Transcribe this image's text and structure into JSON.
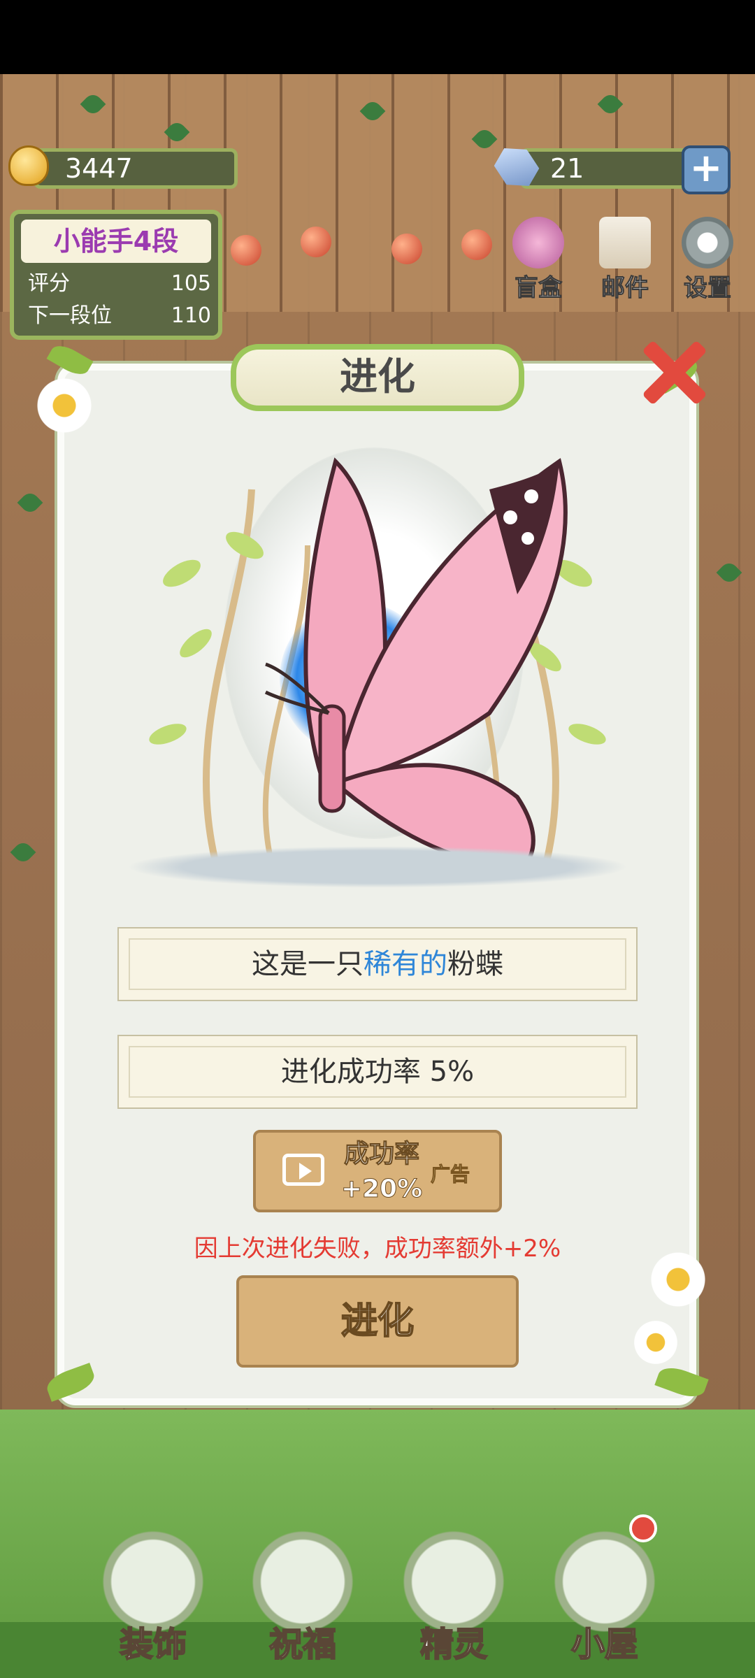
{
  "header": {
    "coins": "3447",
    "gems": "21",
    "plus_label": "+"
  },
  "rank": {
    "title": "小能手4段",
    "score_label": "评分",
    "score_value": "105",
    "next_label": "下一段位",
    "next_value": "110"
  },
  "top_buttons": [
    {
      "label": "盲盒",
      "icon": "blind-box-icon"
    },
    {
      "label": "邮件",
      "icon": "mail-icon"
    },
    {
      "label": "设置",
      "icon": "gear-icon"
    }
  ],
  "dialog": {
    "title": "进化",
    "desc_prefix": "这是一只",
    "desc_highlight": "稀有的",
    "desc_suffix": "粉蝶",
    "rate_text": "进化成功率  5%",
    "ad_button": {
      "line1": "成功率",
      "line2": "+20%",
      "tag": "广告"
    },
    "notice": "因上次进化失败，成功率额外+2%",
    "evolve_button": "进化"
  },
  "bottom_nav": [
    {
      "label": "装饰"
    },
    {
      "label": "祝福"
    },
    {
      "label": "精灵"
    },
    {
      "label": "小屋"
    }
  ],
  "colors": {
    "highlight_blue": "#2e86d8",
    "notice_red": "#e43a32",
    "close_red": "#e24a3e",
    "rank_title_purple": "#9b3bb0"
  }
}
